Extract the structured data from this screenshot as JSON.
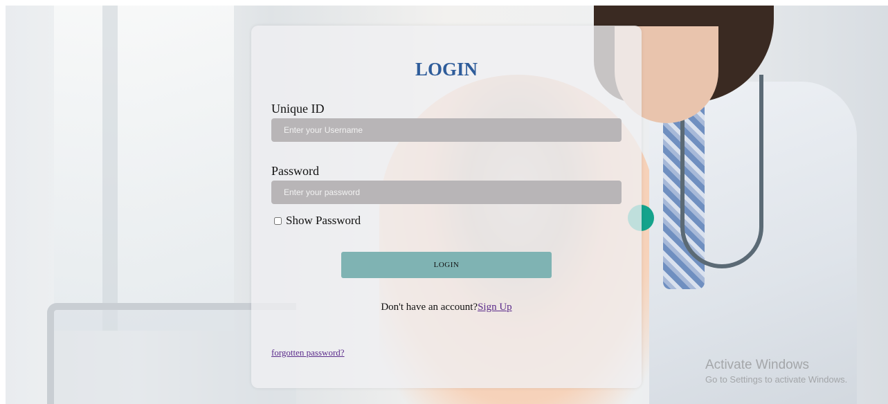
{
  "login": {
    "title": "LOGIN",
    "unique_id_label": "Unique ID",
    "unique_id_placeholder": "Enter your Username",
    "password_label": "Password",
    "password_placeholder": "Enter your password",
    "show_password_label": "Show Password",
    "login_button": "LOGIN",
    "signup_prompt": "Don't have an account?",
    "signup_link": "Sign Up",
    "forgot_link": "forgotten password?"
  },
  "watermark": {
    "title": "Activate Windows",
    "subtitle": "Go to Settings to activate Windows."
  },
  "colors": {
    "title": "#2e5c9a",
    "button": "#7fb3b3",
    "input_bg": "#b8b5b7",
    "link": "#5a2a8a",
    "accent_dot": "#15a38c"
  }
}
